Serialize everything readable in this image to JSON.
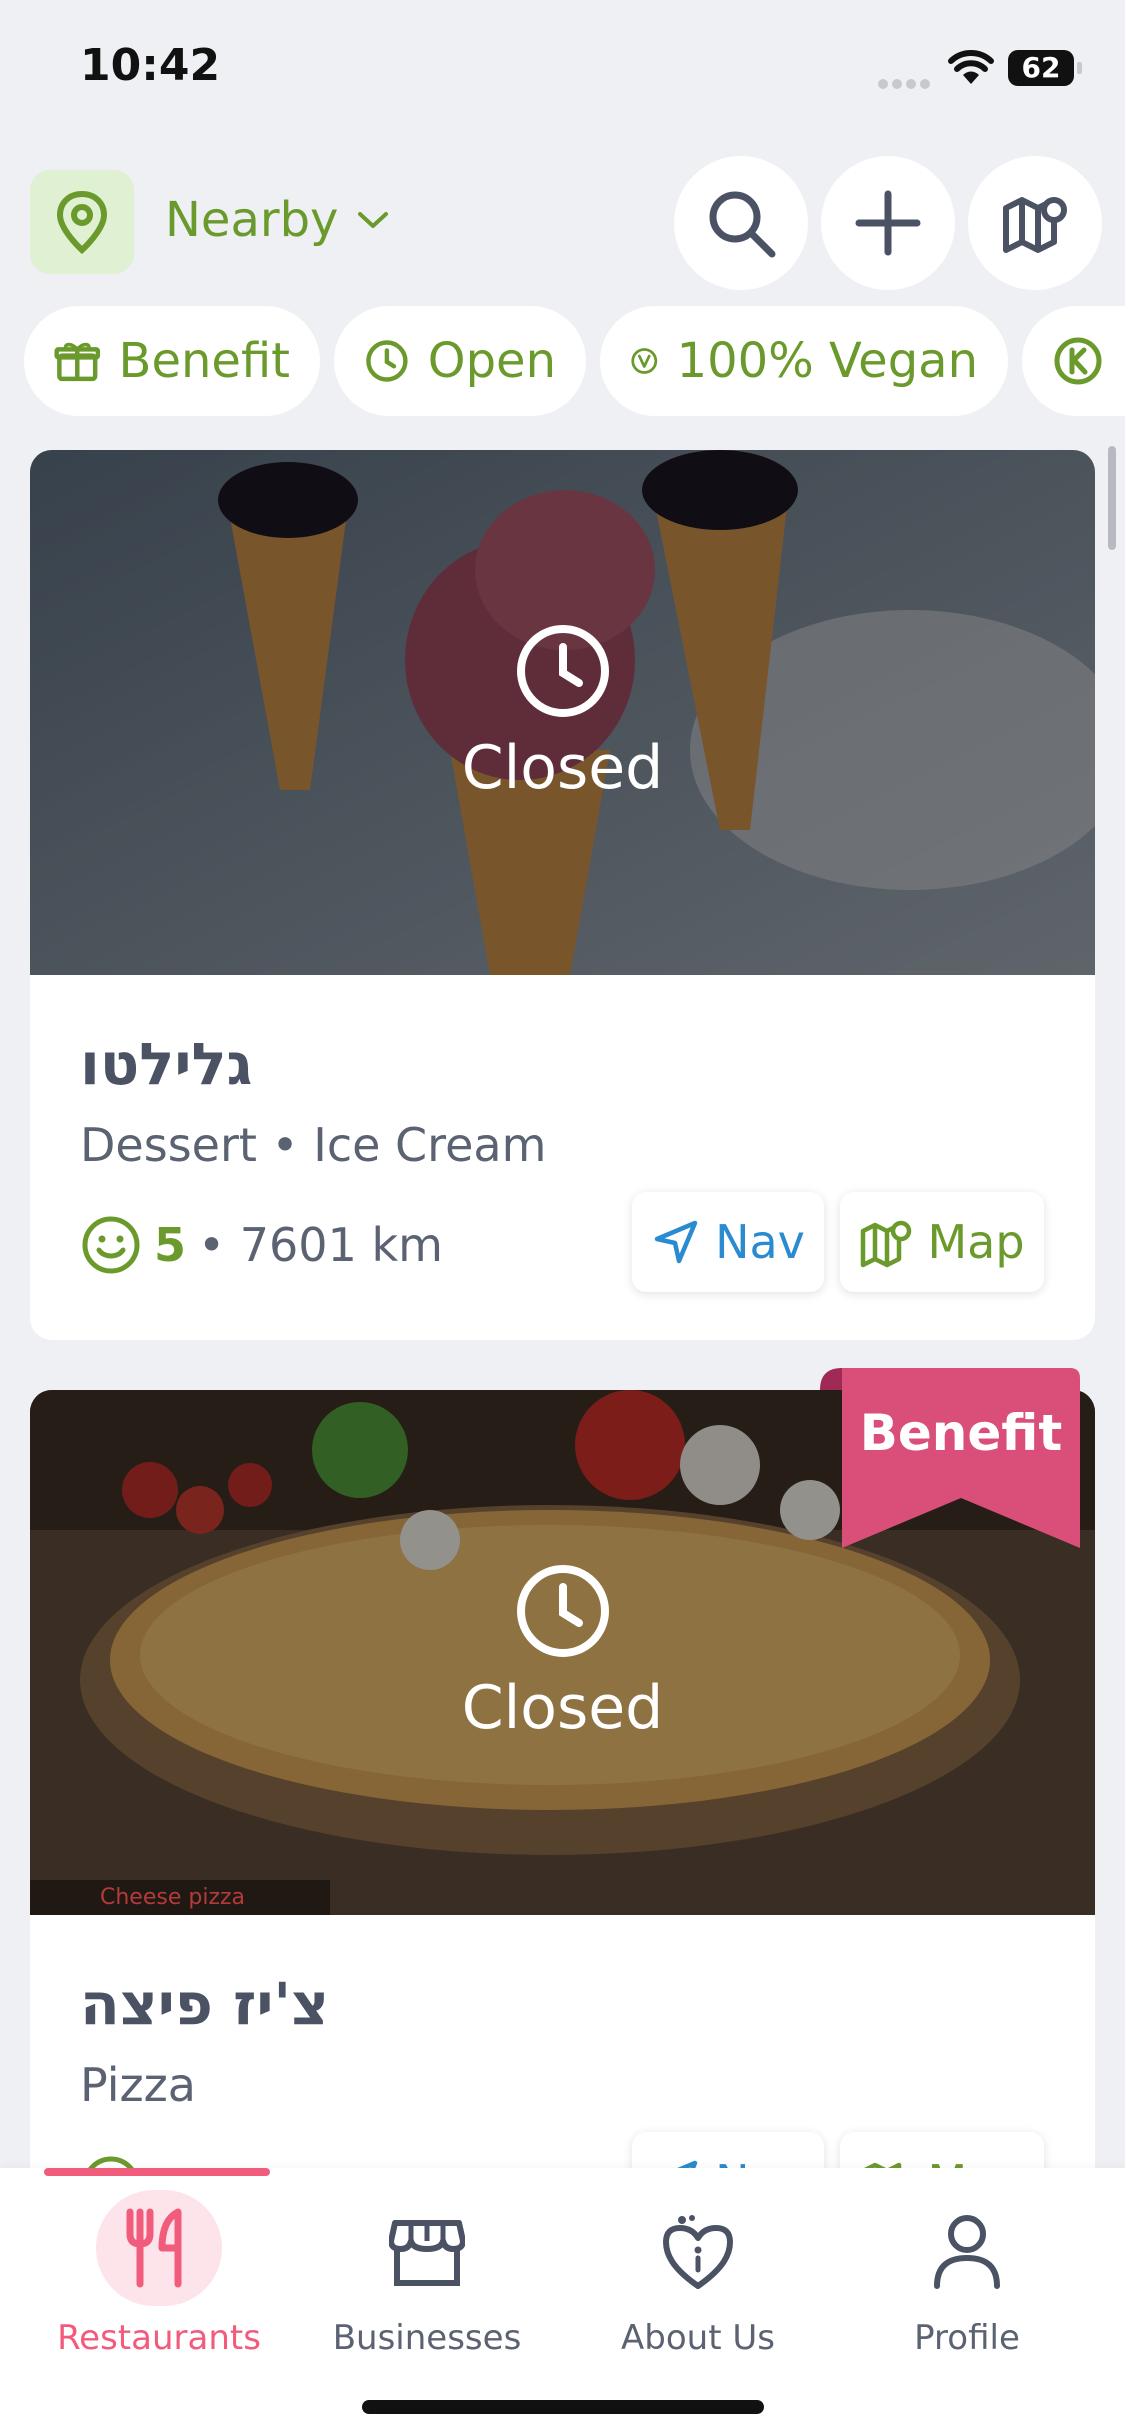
{
  "status": {
    "time": "10:42",
    "battery": "62"
  },
  "header": {
    "location_label": "Nearby"
  },
  "filters": [
    {
      "label": "Benefit",
      "icon": "gift-icon"
    },
    {
      "label": "Open",
      "icon": "clock-icon"
    },
    {
      "label": "100% Vegan",
      "icon": "vegan-icon"
    },
    {
      "label": "",
      "icon": "kosher-icon"
    }
  ],
  "restaurants": [
    {
      "name": "גלילטו",
      "category": "Dessert • Ice Cream",
      "status": "Closed",
      "rating": "5",
      "distance": "• 7601 km",
      "nav_label": "Nav",
      "map_label": "Map"
    },
    {
      "name": "צ'יז פיצה",
      "category": "Pizza",
      "status": "Closed",
      "badge": "Benefit",
      "image_caption": "Cheese pizza",
      "nav_label": "Nav",
      "map_label": "Map"
    }
  ],
  "tabs": [
    {
      "label": "Restaurants",
      "active": true
    },
    {
      "label": "Businesses",
      "active": false
    },
    {
      "label": "About Us",
      "active": false
    },
    {
      "label": "Profile",
      "active": false
    }
  ],
  "colors": {
    "accent_green": "#6b9a2c",
    "accent_pink": "#f25c7c",
    "ribbon_pink": "#d94f7a",
    "nav_blue": "#2a8bd0",
    "background": "#eef0f4"
  }
}
